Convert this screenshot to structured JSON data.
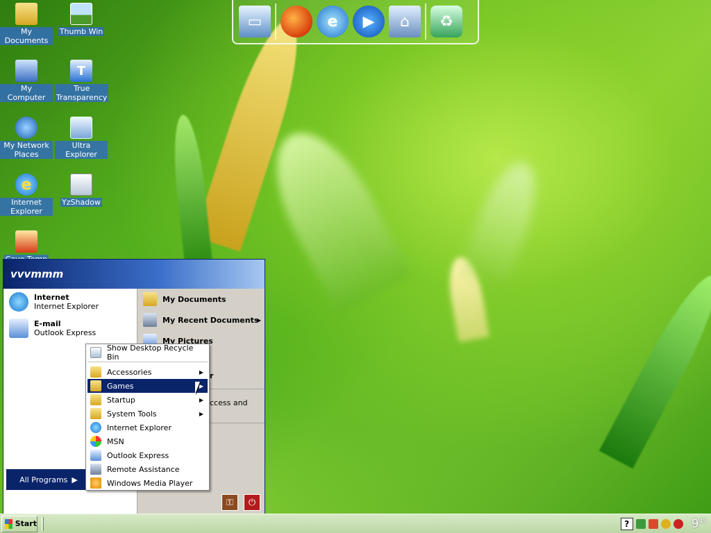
{
  "desktop": {
    "icons": [
      {
        "label": "My Documents",
        "icon": "folder-documents-icon"
      },
      {
        "label": "Thumb Win",
        "icon": "thumbnail-window-icon"
      },
      {
        "label": "My Computer",
        "icon": "computer-icon"
      },
      {
        "label": "True Transparency",
        "icon": "transparency-app-icon"
      },
      {
        "label": "My Network Places",
        "icon": "network-globe-icon"
      },
      {
        "label": "Ultra Explorer",
        "icon": "explorer-window-icon"
      },
      {
        "label": "Internet Explorer",
        "icon": "internet-explorer-icon"
      },
      {
        "label": "YzShadow",
        "icon": "shadow-window-icon"
      },
      {
        "label": "Cave Temp",
        "icon": "thermometer-icon"
      }
    ]
  },
  "dock": {
    "items": [
      "monitor-icon",
      "firefox-icon",
      "internet-explorer-icon",
      "media-player-play-icon",
      "network-connection-icon",
      "recycle-bin-icon"
    ]
  },
  "start_menu": {
    "user_name": "vvvmmm",
    "pinned": [
      {
        "title": "Internet",
        "subtitle": "Internet Explorer"
      },
      {
        "title": "E-mail",
        "subtitle": "Outlook Express"
      }
    ],
    "all_programs_label": "All Programs",
    "right": {
      "my_documents": "My Documents",
      "my_recent_documents": "My Recent Documents",
      "my_pictures": "My Pictures",
      "partial_r": "r",
      "partial_access": "ccess and"
    }
  },
  "submenu": {
    "top_item": "Show Desktop Recycle Bin",
    "folders": [
      "Accessories",
      "Games",
      "Startup",
      "System Tools"
    ],
    "apps": [
      "Internet Explorer",
      "MSN",
      "Outlook Express",
      "Remote Assistance",
      "Windows Media Player"
    ],
    "active_item": "Games"
  },
  "taskbar": {
    "start_label": "Start",
    "help_label": "?",
    "clock": "9",
    "clock_minutes": "45"
  }
}
